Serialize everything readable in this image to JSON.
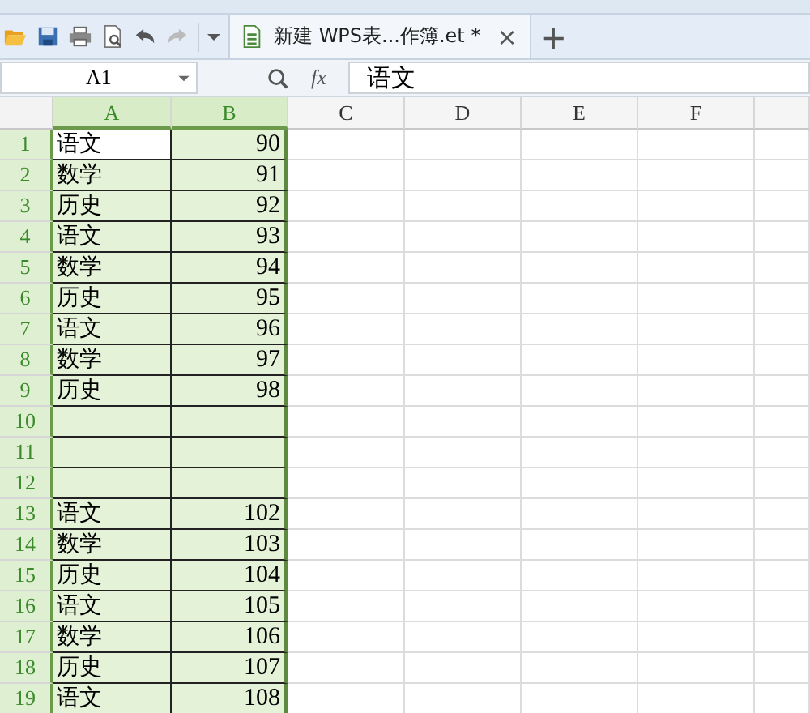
{
  "toolbar": {
    "tab": {
      "title": "新建 WPS表...作簿.et *",
      "close": "×",
      "selected": true
    },
    "new_tab": "+"
  },
  "formula_bar": {
    "name_box": "A1",
    "fx": "fx",
    "value": "语文"
  },
  "columns": [
    {
      "label": "A",
      "selected": true
    },
    {
      "label": "B",
      "selected": true
    },
    {
      "label": "C",
      "selected": false
    },
    {
      "label": "D",
      "selected": false
    },
    {
      "label": "E",
      "selected": false
    },
    {
      "label": "F",
      "selected": false
    }
  ],
  "rows": [
    {
      "number": "1",
      "selected": true,
      "cells": [
        {
          "text": "语文",
          "active": true
        },
        {
          "text": "90",
          "active": false
        }
      ]
    },
    {
      "number": "2",
      "selected": true,
      "cells": [
        {
          "text": "数学",
          "active": false
        },
        {
          "text": "91",
          "active": false
        }
      ]
    },
    {
      "number": "3",
      "selected": true,
      "cells": [
        {
          "text": "历史",
          "active": false
        },
        {
          "text": "92",
          "active": false
        }
      ]
    },
    {
      "number": "4",
      "selected": true,
      "cells": [
        {
          "text": "语文",
          "active": false
        },
        {
          "text": "93",
          "active": false
        }
      ]
    },
    {
      "number": "5",
      "selected": true,
      "cells": [
        {
          "text": "数学",
          "active": false
        },
        {
          "text": "94",
          "active": false
        }
      ]
    },
    {
      "number": "6",
      "selected": true,
      "cells": [
        {
          "text": "历史",
          "active": false
        },
        {
          "text": "95",
          "active": false
        }
      ]
    },
    {
      "number": "7",
      "selected": true,
      "cells": [
        {
          "text": "语文",
          "active": false
        },
        {
          "text": "96",
          "active": false
        }
      ]
    },
    {
      "number": "8",
      "selected": true,
      "cells": [
        {
          "text": "数学",
          "active": false
        },
        {
          "text": "97",
          "active": false
        }
      ]
    },
    {
      "number": "9",
      "selected": true,
      "cells": [
        {
          "text": "历史",
          "active": false
        },
        {
          "text": "98",
          "active": false
        }
      ]
    },
    {
      "number": "10",
      "selected": true,
      "cells": [
        {
          "active": false
        },
        {
          "active": false
        }
      ]
    },
    {
      "number": "11",
      "selected": true,
      "cells": [
        {
          "active": false
        },
        {
          "active": false
        }
      ]
    },
    {
      "number": "12",
      "selected": true,
      "cells": [
        {
          "active": false
        },
        {
          "active": false
        }
      ]
    },
    {
      "number": "13",
      "selected": true,
      "cells": [
        {
          "text": "语文",
          "active": false
        },
        {
          "text": "102",
          "active": false
        }
      ]
    },
    {
      "number": "14",
      "selected": true,
      "cells": [
        {
          "text": "数学",
          "active": false
        },
        {
          "text": "103",
          "active": false
        }
      ]
    },
    {
      "number": "15",
      "selected": true,
      "cells": [
        {
          "text": "历史",
          "active": false
        },
        {
          "text": "104",
          "active": false
        }
      ]
    },
    {
      "number": "16",
      "selected": true,
      "cells": [
        {
          "text": "语文",
          "active": false
        },
        {
          "text": "105",
          "active": false
        }
      ]
    },
    {
      "number": "17",
      "selected": true,
      "cells": [
        {
          "text": "数学",
          "active": false
        },
        {
          "text": "106",
          "active": false
        }
      ]
    },
    {
      "number": "18",
      "selected": true,
      "cells": [
        {
          "text": "历史",
          "active": false
        },
        {
          "text": "107",
          "active": false
        }
      ]
    },
    {
      "number": "19",
      "selected": true,
      "cells": [
        {
          "text": "语文",
          "active": false
        },
        {
          "text": "108",
          "active": false
        }
      ]
    }
  ]
}
